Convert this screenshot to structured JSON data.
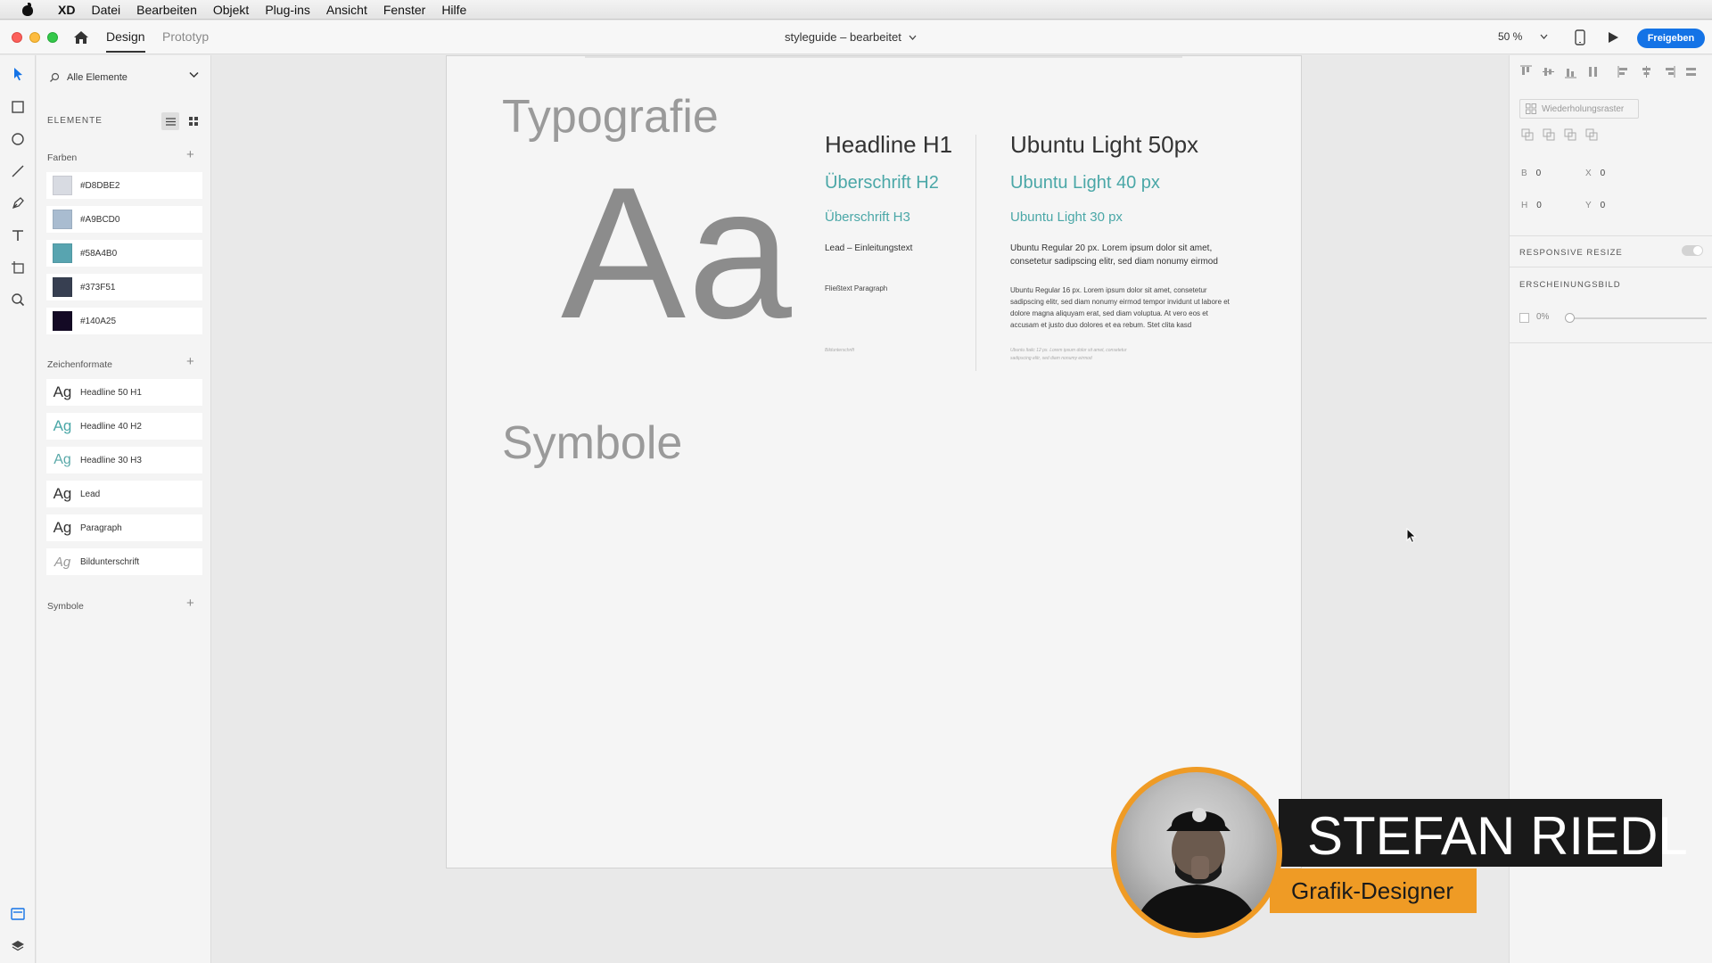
{
  "menubar": {
    "app": "XD",
    "items": [
      "Datei",
      "Bearbeiten",
      "Objekt",
      "Plug-ins",
      "Ansicht",
      "Fenster",
      "Hilfe"
    ]
  },
  "titlebar": {
    "tab_design": "Design",
    "tab_prototype": "Prototyp",
    "document_title": "styleguide – bearbeitet",
    "zoom": "50 %",
    "share_label": "Freigeben"
  },
  "assets": {
    "filter_label": "Alle Elemente",
    "section_title": "ELEMENTE",
    "colors_title": "Farben",
    "colors": [
      {
        "label": "#D8DBE2",
        "hex": "#D8DBE2"
      },
      {
        "label": "#A9BCD0",
        "hex": "#A9BCD0"
      },
      {
        "label": "#58A4B0",
        "hex": "#58A4B0"
      },
      {
        "label": "#373F51",
        "hex": "#373F51"
      },
      {
        "label": "#140A25",
        "hex": "#140A25"
      }
    ],
    "char_title": "Zeichenformate",
    "char_styles": [
      {
        "sample": "Ag",
        "label": "Headline 50 H1"
      },
      {
        "sample": "Ag",
        "label": "Headline 40 H2"
      },
      {
        "sample": "Ag",
        "label": "Headline 30 H3"
      },
      {
        "sample": "Ag",
        "label": "Lead"
      },
      {
        "sample": "Ag",
        "label": "Paragraph"
      },
      {
        "sample": "Ag",
        "label": "Bildunterschrift"
      }
    ],
    "symbols_title": "Symbole"
  },
  "artboard": {
    "heading_typo": "Typografie",
    "sample_glyph": "Aa",
    "heading_symbols": "Symbole",
    "left_column": {
      "h1": "Headline H1",
      "h2": "Überschrift H2",
      "h3": "Überschrift H3",
      "lead": "Lead – Einleitungstext",
      "paragraph": "Fließtext Paragraph",
      "caption": "Bildunterschrift"
    },
    "right_column": {
      "h1": "Ubuntu Light 50px",
      "h2": "Ubuntu Light 40 px",
      "h3": "Ubuntu Light 30 px",
      "lead": "Ubuntu Regular 20 px. Lorem ipsum dolor sit amet, consetetur sadipscing elitr, sed diam nonumy eirmod",
      "paragraph": "Ubuntu Regular 16 px. Lorem ipsum dolor sit amet, consetetur sadipscing elitr, sed diam nonumy eirmod tempor invidunt ut labore et dolore magna aliquyam erat, sed diam voluptua. At vero eos et accusam et justo duo dolores et ea rebum. Stet clita kasd",
      "caption": "Ubuntu Italic 12 px. Lorem ipsum dolor sit amet, consetetur sadipscing elitr, sed diam nonumy eirmod"
    }
  },
  "overlay": {
    "name": "STEFAN RIEDL",
    "role": "Grafik-Designer"
  },
  "properties": {
    "repeat_grid": "Wiederholungsraster",
    "w_label": "B",
    "w_value": "0",
    "x_label": "X",
    "x_value": "0",
    "h_label": "H",
    "h_value": "0",
    "y_label": "Y",
    "y_value": "0",
    "responsive_resize": "RESPONSIVE RESIZE",
    "appearance": "ERSCHEINUNGSBILD",
    "opacity": "0%"
  },
  "colors": {
    "accent": "#1473e6",
    "teal_text": "#4aa7a7",
    "overlay_orange": "#ef9b25"
  }
}
